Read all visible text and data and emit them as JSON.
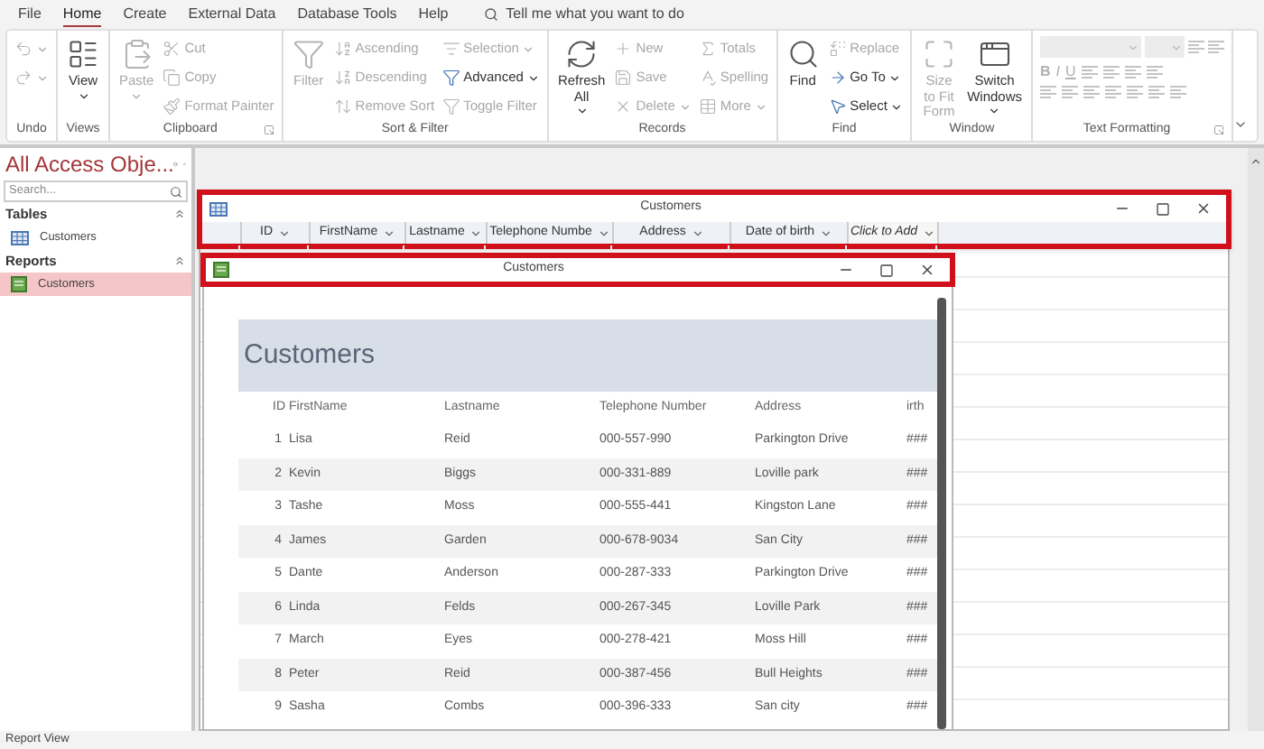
{
  "menu": [
    {
      "label": "File",
      "selected": false
    },
    {
      "label": "Home",
      "selected": true
    },
    {
      "label": "Create",
      "selected": false
    },
    {
      "label": "External Data",
      "selected": false
    },
    {
      "label": "Database Tools",
      "selected": false
    },
    {
      "label": "Help",
      "selected": false
    }
  ],
  "tell_me": {
    "placeholder": "Tell me what you want to do"
  },
  "ribbon": [
    {
      "label": "Undo",
      "cols": [
        {
          "kind": "column",
          "items": [
            {
              "disabled": true,
              "dropdown": true
            },
            {
              "disabled": true,
              "dropdown": true
            }
          ]
        }
      ]
    },
    {
      "label": "Views",
      "cols": [
        {
          "kind": "large",
          "label": "View",
          "disabled": false,
          "dropdown": true
        }
      ]
    },
    {
      "label": "Clipboard",
      "launcher": true,
      "cols": [
        {
          "kind": "large",
          "label": "Paste",
          "disabled": true,
          "dropdown": true
        },
        {
          "kind": "column",
          "items": [
            {
              "label": "Cut",
              "disabled": true
            },
            {
              "label": "Copy",
              "disabled": true
            },
            {
              "label": "Format Painter",
              "disabled": true
            }
          ]
        }
      ]
    },
    {
      "label": "Sort & Filter",
      "cols": [
        {
          "kind": "large",
          "label": "Filter",
          "disabled": true
        },
        {
          "kind": "column",
          "items": [
            {
              "label": "Ascending",
              "disabled": true
            },
            {
              "label": "Descending",
              "disabled": true
            },
            {
              "label": "Remove Sort",
              "disabled": true
            }
          ]
        },
        {
          "kind": "column",
          "items": [
            {
              "label": "Selection",
              "disabled": true,
              "dropdown": true
            },
            {
              "label": "Advanced",
              "disabled": false,
              "dropdown": true
            },
            {
              "label": "Toggle Filter",
              "disabled": true
            }
          ]
        }
      ]
    },
    {
      "label": "Records",
      "cols": [
        {
          "kind": "large",
          "label": "Refresh All",
          "disabled": false,
          "dropdown": true
        },
        {
          "kind": "column",
          "items": [
            {
              "label": "New",
              "disabled": true
            },
            {
              "label": "Save",
              "disabled": true
            },
            {
              "label": "Delete",
              "disabled": true,
              "dropdown": true
            }
          ]
        },
        {
          "kind": "column",
          "items": [
            {
              "label": "Totals",
              "disabled": true
            },
            {
              "label": "Spelling",
              "disabled": true
            },
            {
              "label": "More",
              "disabled": true,
              "dropdown": true
            }
          ]
        }
      ]
    },
    {
      "label": "Find",
      "cols": [
        {
          "kind": "large",
          "label": "Find",
          "disabled": false
        },
        {
          "kind": "column",
          "items": [
            {
              "label": "Replace",
              "disabled": true
            },
            {
              "label": "Go To",
              "disabled": false,
              "dropdown": true
            },
            {
              "label": "Select",
              "disabled": false,
              "dropdown": true
            }
          ]
        }
      ]
    },
    {
      "label": "Window",
      "cols": [
        {
          "kind": "large",
          "label": "Size to Fit Form",
          "disabled": true
        },
        {
          "kind": "large",
          "label": "Switch Windows",
          "disabled": false,
          "dropdown": true
        }
      ]
    },
    {
      "label": "Text Formatting",
      "launcher": true,
      "cols": [
        {
          "kind": "format",
          "buttons": [
            "B",
            "I",
            "U"
          ],
          "disabled": true
        }
      ]
    }
  ],
  "nav": {
    "title": "All Access Obje...",
    "search": {
      "placeholder": "Search..."
    },
    "sections": [
      {
        "label": "Tables",
        "kind": "table",
        "expanded": true,
        "items": [
          {
            "label": "Customers",
            "selected": false
          }
        ]
      },
      {
        "label": "Reports",
        "kind": "report",
        "expanded": true,
        "items": [
          {
            "label": "Customers",
            "selected": true
          }
        ]
      }
    ]
  },
  "table_window": {
    "title": "Customers",
    "highlighted": true,
    "columns": [
      {
        "label": "ID",
        "kind": "field"
      },
      {
        "label": "FirstName",
        "kind": "field"
      },
      {
        "label": "Lastname",
        "kind": "field"
      },
      {
        "label": "Telephone Numbe",
        "kind": "field"
      },
      {
        "label": "Address",
        "kind": "field"
      },
      {
        "label": "Date of birth",
        "kind": "field"
      },
      {
        "label": "Click to Add",
        "kind": "add"
      }
    ]
  },
  "report_window": {
    "title": "Customers",
    "highlighted": true,
    "report_title": "Customers",
    "columns": [
      "ID",
      "FirstName",
      "Lastname",
      "Telephone Number",
      "Address",
      "irth"
    ],
    "rows": [
      [
        "1",
        "Lisa",
        "Reid",
        "000-557-990",
        "Parkington Drive",
        "###"
      ],
      [
        "2",
        "Kevin",
        "Biggs",
        "000-331-889",
        "Loville  park",
        "###"
      ],
      [
        "3",
        "Tashe",
        "Moss",
        "000-555-441",
        "Kingston Lane",
        "###"
      ],
      [
        "4",
        "James",
        "Garden",
        "000-678-9034",
        "San City",
        "###"
      ],
      [
        "5",
        "Dante",
        "Anderson",
        "000-287-333",
        "Parkington Drive",
        "###"
      ],
      [
        "6",
        "Linda",
        "Felds",
        "000-267-345",
        "Loville Park",
        "###"
      ],
      [
        "7",
        "March",
        "Eyes",
        "000-278-421",
        "Moss Hill",
        "###"
      ],
      [
        "8",
        "Peter",
        "Reid",
        "000-387-456",
        "Bull Heights",
        "###"
      ],
      [
        "9",
        "Sasha",
        "Combs",
        "000-396-333",
        "San city",
        "###"
      ]
    ]
  },
  "status_bar": "Report View"
}
